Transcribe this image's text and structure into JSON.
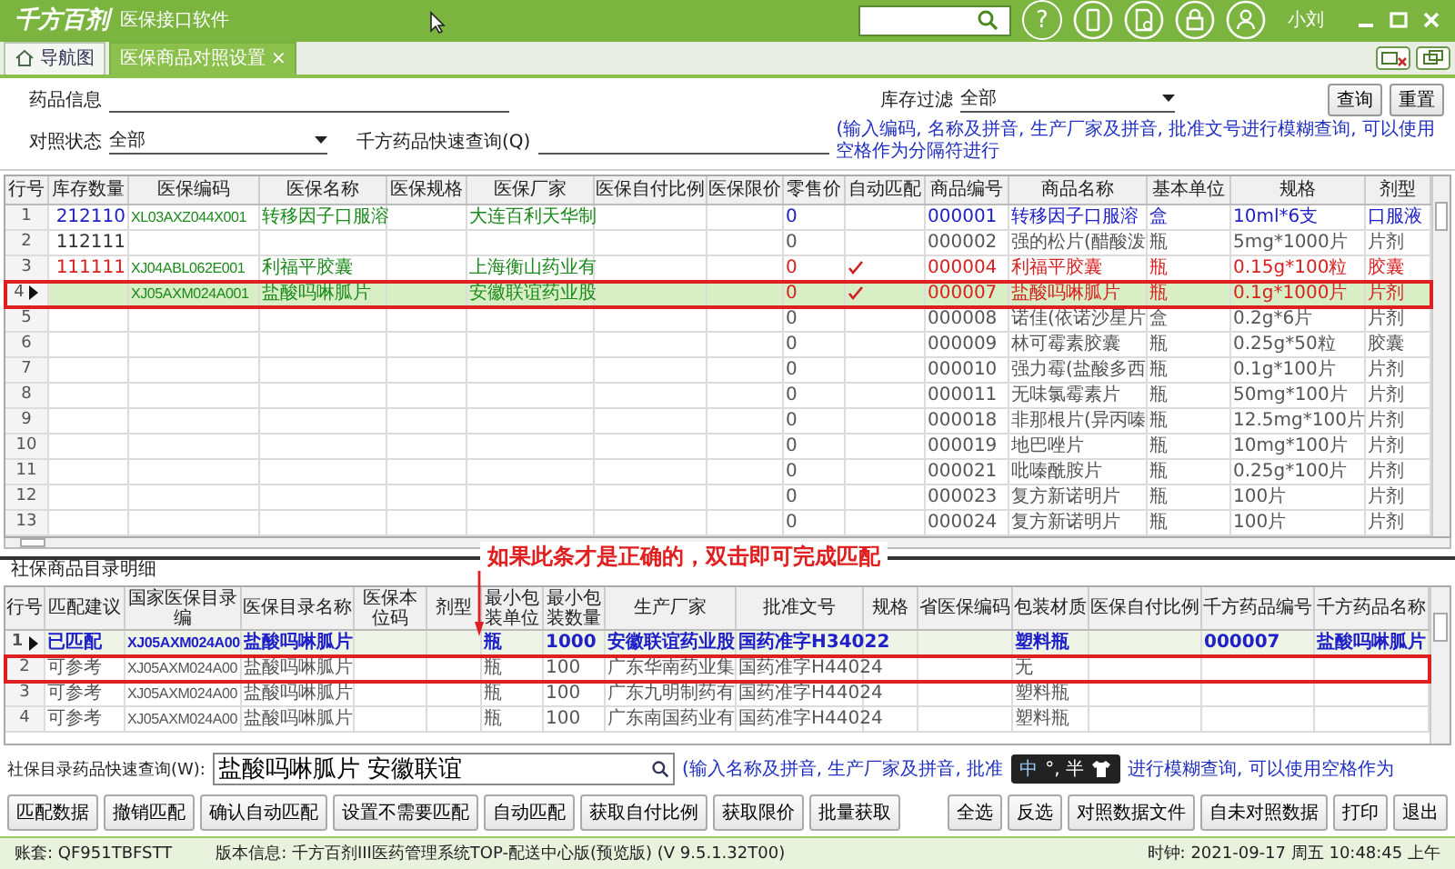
{
  "app": {
    "logo": "千方百剂",
    "title": "医保接口软件",
    "user": "小刘",
    "help": "?"
  },
  "tabs": [
    {
      "label": "导航图",
      "kind": "home",
      "selected": false
    },
    {
      "label": "医保商品对照设置",
      "kind": "page",
      "selected": true,
      "close": "×"
    }
  ],
  "filters": {
    "drug_label": "药品信息",
    "stock_label": "库存过滤",
    "stock_value": "全部",
    "status_label": "对照状态",
    "status_value": "全部",
    "quick_label": "千方药品快速查询(Q)",
    "hint": "(输入编码, 名称及拼音, 生产厂家及拼音, 批准文号进行模糊查询, 可以使用空格作为分隔符进行",
    "buttons": [
      "查询",
      "重置"
    ]
  },
  "products": {
    "columns": [
      {
        "label": "行号",
        "kind": "index"
      },
      {
        "label": "库存数量",
        "kind": "stock"
      },
      {
        "label": "医保编码",
        "kind": "code"
      },
      {
        "label": "医保名称",
        "kind": "insurance"
      },
      {
        "label": "医保规格",
        "kind": "insurance"
      },
      {
        "label": "医保厂家",
        "kind": "insurance"
      },
      {
        "label": "医保自付比例",
        "kind": "insurance"
      },
      {
        "label": "医保限价",
        "kind": "insurance"
      },
      {
        "label": "零售价",
        "kind": "product"
      },
      {
        "label": "自动匹配",
        "kind": "check"
      },
      {
        "label": "商品编号",
        "kind": "product"
      },
      {
        "label": "商品名称",
        "kind": "product"
      },
      {
        "label": "基本单位",
        "kind": "product"
      },
      {
        "label": "规格",
        "kind": "product"
      },
      {
        "label": "剂型",
        "kind": "product"
      }
    ],
    "rows": [
      {
        "kind": "manual",
        "selected": false,
        "boxed": false,
        "auto_matched": false,
        "cells": [
          "1",
          "212110",
          "XL03AXZ044X001",
          "转移因子口服溶",
          null,
          "大连百利天华制",
          null,
          null,
          "0",
          null,
          "000001",
          "转移因子口服溶",
          "盒",
          "10ml*6支",
          "口服液"
        ]
      },
      {
        "kind": "none",
        "selected": false,
        "boxed": false,
        "auto_matched": false,
        "cells": [
          "2",
          "112111",
          null,
          null,
          null,
          null,
          null,
          null,
          "0",
          null,
          "000002",
          "强的松片(醋酸泼",
          "瓶",
          "5mg*1000片",
          "片剂"
        ]
      },
      {
        "kind": "auto",
        "selected": false,
        "boxed": false,
        "auto_matched": true,
        "cells": [
          "3",
          "111111",
          "XJ04ABL062E001",
          "利福平胶囊",
          null,
          "上海衡山药业有",
          null,
          null,
          "0",
          null,
          "000004",
          "利福平胶囊",
          "瓶",
          "0.15g*100粒",
          "胶囊"
        ]
      },
      {
        "kind": "auto",
        "selected": true,
        "boxed": true,
        "auto_matched": true,
        "cells": [
          "4",
          null,
          "XJ05AXM024A001",
          "盐酸吗啉胍片",
          null,
          "安徽联谊药业股",
          null,
          null,
          "0",
          null,
          "000007",
          "盐酸吗啉胍片",
          "瓶",
          "0.1g*1000片",
          "片剂"
        ]
      },
      {
        "kind": "none",
        "selected": false,
        "boxed": false,
        "auto_matched": false,
        "cells": [
          "5",
          null,
          null,
          null,
          null,
          null,
          null,
          null,
          "0",
          null,
          "000008",
          "诺佳(依诺沙星片",
          "盒",
          "0.2g*6片",
          "片剂"
        ]
      },
      {
        "kind": "none",
        "selected": false,
        "boxed": false,
        "auto_matched": false,
        "cells": [
          "6",
          null,
          null,
          null,
          null,
          null,
          null,
          null,
          "0",
          null,
          "000009",
          "林可霉素胶囊",
          "瓶",
          "0.25g*50粒",
          "胶囊"
        ]
      },
      {
        "kind": "none",
        "selected": false,
        "boxed": false,
        "auto_matched": false,
        "cells": [
          "7",
          null,
          null,
          null,
          null,
          null,
          null,
          null,
          "0",
          null,
          "000010",
          "强力霉(盐酸多西",
          "瓶",
          "0.1g*100片",
          "片剂"
        ]
      },
      {
        "kind": "none",
        "selected": false,
        "boxed": false,
        "auto_matched": false,
        "cells": [
          "8",
          null,
          null,
          null,
          null,
          null,
          null,
          null,
          "0",
          null,
          "000011",
          "无味氯霉素片",
          "瓶",
          "50mg*100片",
          "片剂"
        ]
      },
      {
        "kind": "none",
        "selected": false,
        "boxed": false,
        "auto_matched": false,
        "cells": [
          "9",
          null,
          null,
          null,
          null,
          null,
          null,
          null,
          "0",
          null,
          "000018",
          "非那根片(异丙嗪",
          "瓶",
          "12.5mg*100片",
          "片剂"
        ]
      },
      {
        "kind": "none",
        "selected": false,
        "boxed": false,
        "auto_matched": false,
        "cells": [
          "10",
          null,
          null,
          null,
          null,
          null,
          null,
          null,
          "0",
          null,
          "000019",
          "地巴唑片",
          "瓶",
          "10mg*100片",
          "片剂"
        ]
      },
      {
        "kind": "none",
        "selected": false,
        "boxed": false,
        "auto_matched": false,
        "cells": [
          "11",
          null,
          null,
          null,
          null,
          null,
          null,
          null,
          "0",
          null,
          "000021",
          "吡嗪酰胺片",
          "瓶",
          "0.25g*100片",
          "片剂"
        ]
      },
      {
        "kind": "none",
        "selected": false,
        "boxed": false,
        "auto_matched": false,
        "cells": [
          "12",
          null,
          null,
          null,
          null,
          null,
          null,
          null,
          "0",
          null,
          "000023",
          "复方新诺明片",
          "瓶",
          "100片",
          "片剂"
        ]
      },
      {
        "kind": "none",
        "selected": false,
        "boxed": false,
        "auto_matched": false,
        "cells": [
          "13",
          null,
          null,
          null,
          null,
          null,
          null,
          null,
          "0",
          null,
          "000024",
          "复方新诺明片",
          "瓶",
          "100片",
          "片剂"
        ]
      }
    ]
  },
  "catalog": {
    "title": "社保商品目录明细",
    "annotation": "如果此条才是正确的，双击即可完成匹配",
    "columns": [
      {
        "label": "行号",
        "kind": "index"
      },
      {
        "label": "匹配建议",
        "kind": "text"
      },
      {
        "label": "国家医保目录编",
        "kind": "code"
      },
      {
        "label": "医保目录名称",
        "kind": "text"
      },
      {
        "label": "医保本位码",
        "kind": "text"
      },
      {
        "label": "剂型",
        "kind": "text"
      },
      {
        "label": "最小包装单位",
        "kind": "text"
      },
      {
        "label": "最小包装数量",
        "kind": "text"
      },
      {
        "label": "生产厂家",
        "kind": "text"
      },
      {
        "label": "批准文号",
        "kind": "text"
      },
      {
        "label": "规格",
        "kind": "text"
      },
      {
        "label": "省医保编码",
        "kind": "text"
      },
      {
        "label": "包装材质",
        "kind": "text"
      },
      {
        "label": "医保自付比例",
        "kind": "text"
      },
      {
        "label": "千方药品编号",
        "kind": "text"
      },
      {
        "label": "千方药品名称",
        "kind": "text"
      }
    ],
    "rows": [
      {
        "kind": "matched",
        "selected": true,
        "boxed": false,
        "cells": [
          "1",
          "已匹配",
          "XJ05AXM024A00",
          "盐酸吗啉胍片",
          null,
          null,
          "瓶",
          "1000",
          "安徽联谊药业股",
          "国药准字H34022",
          null,
          null,
          "塑料瓶",
          null,
          "000007",
          "盐酸吗啉胍片"
        ]
      },
      {
        "kind": "reference",
        "selected": false,
        "boxed": true,
        "cells": [
          "2",
          "可参考",
          "XJ05AXM024A00",
          "盐酸吗啉胍片",
          null,
          null,
          "瓶",
          "100",
          "广东华南药业集",
          "国药准字H44024",
          null,
          null,
          "无",
          null,
          null,
          null
        ]
      },
      {
        "kind": "reference",
        "selected": false,
        "boxed": false,
        "cells": [
          "3",
          "可参考",
          "XJ05AXM024A00",
          "盐酸吗啉胍片",
          null,
          null,
          "瓶",
          "100",
          "广东九明制药有",
          "国药准字H44024",
          null,
          null,
          "塑料瓶",
          null,
          null,
          null
        ]
      },
      {
        "kind": "reference",
        "selected": false,
        "boxed": false,
        "cells": [
          "4",
          "可参考",
          "XJ05AXM024A00",
          "盐酸吗啉胍片",
          null,
          null,
          "瓶",
          "100",
          "广东南国药业有",
          "国药准字H44024",
          null,
          null,
          "塑料瓶",
          null,
          null,
          null
        ]
      }
    ]
  },
  "search": {
    "label": "社保目录药品快速查询(W):",
    "value": "盐酸吗啉胍片 安徽联谊",
    "hint_before": "(输入名称及拼音, 生产厂家及拼音, 批准",
    "hint_after": "进行模糊查询, 可以使用空格作为"
  },
  "ime": {
    "mode": "中",
    "marks": "°, 半"
  },
  "actions_left": [
    "匹配数据",
    "撤销匹配",
    "确认自动匹配",
    "设置不需要匹配",
    "自动匹配",
    "获取自付比例",
    "获取限价",
    "批量获取"
  ],
  "actions_right": [
    "全选",
    "反选",
    "对照数据文件",
    "自未对照数据",
    "打印",
    "退出"
  ],
  "status_bar": {
    "account": "账套: QF951TBFSTT",
    "version": "版本信息: 千方百剂III医药管理系统TOP-配送中心版(预览版)  (V 9.5.1.32T00)",
    "clock": "时钟: 2021-09-17 周五 10:48:45 上午"
  }
}
